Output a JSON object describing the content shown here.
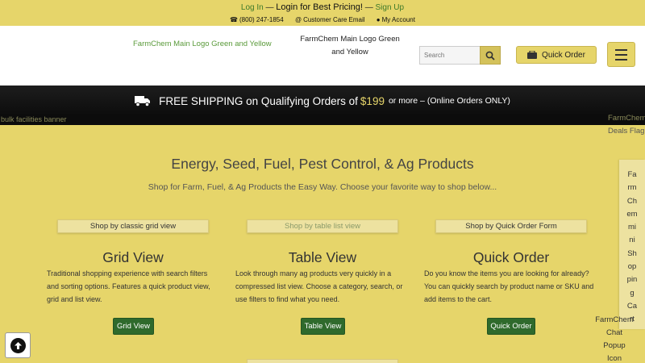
{
  "topbar": {
    "login": "Log In",
    "sep1": "—",
    "cta": "Login for Best Pricing!",
    "sep2": "—",
    "signup": "Sign Up",
    "phone": "(800) 247-1854",
    "email": "Customer Care Email",
    "account": "My Account"
  },
  "header": {
    "logo_alt_left": "FarmChem Main Logo Green and Yellow",
    "logo_alt_center": "FarmChem Main Logo Green and Yellow",
    "search_placeholder": "Search",
    "quick_order": "Quick Order"
  },
  "shipping": {
    "text": "FREE SHIPPING on Qualifying Orders of",
    "price": "$199",
    "suffix": "or more – (Online Orders ONLY)"
  },
  "banner": {
    "bulk_alt": "bulk facilities banner",
    "deals_line1": "FarmChem",
    "deals_line2": "Deals Flag"
  },
  "main": {
    "heading": "Energy, Seed, Fuel, Pest Control, & Ag Products",
    "subheading": "Shop for Farm, Fuel, & Ag Products the Easy Way. Choose your favorite way to shop below..."
  },
  "columns": [
    {
      "tab": "Shop by classic grid view",
      "title": "Grid View",
      "desc": "Traditional shopping experience with search filters and sorting options. Features a quick product view, grid and list view.",
      "button": "Grid View"
    },
    {
      "tab": "Shop by table list view",
      "title": "Table View",
      "desc": "Look through many ag products very quickly in a compressed list view. Choose a category, search, or use filters to find what you need.",
      "button": "Table View"
    },
    {
      "tab": "Shop by Quick Order Form",
      "title": "Quick Order",
      "desc": "Do you know the items you are looking for already? You can quickly search by product name or SKU and add items to the cart.",
      "button": "Quick Order"
    }
  ],
  "sidebar": {
    "chat_tab": "FarmChem mini Shopping Cart",
    "chat_icon": "FarmChem Chat Popup Icon"
  },
  "colors": {
    "brand_yellow": "#e6d56a",
    "brand_green": "#2f6a2c",
    "banner_black": "#111111"
  }
}
